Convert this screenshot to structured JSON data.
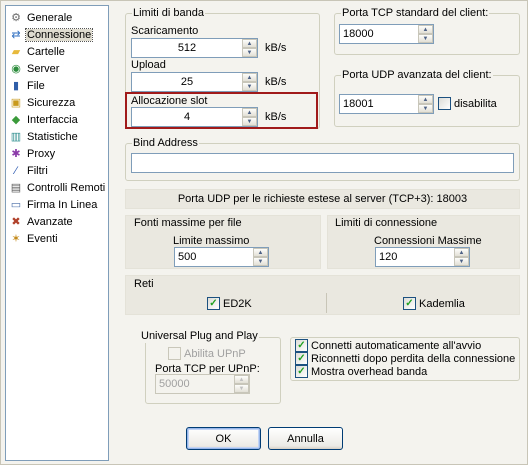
{
  "sidebar": {
    "items": [
      {
        "label": "Generale",
        "icon": "gear-icon",
        "glyph": "⚙",
        "color": "#6b6b6b",
        "selected": false
      },
      {
        "label": "Connessione",
        "icon": "connection-icon",
        "glyph": "⇄",
        "color": "#2e6ec0",
        "selected": true
      },
      {
        "label": "Cartelle",
        "icon": "folder-icon",
        "glyph": "▰",
        "color": "#e7b93c",
        "selected": false
      },
      {
        "label": "Server",
        "icon": "server-icon",
        "glyph": "◉",
        "color": "#2c8c3c",
        "selected": false
      },
      {
        "label": "File",
        "icon": "file-icon",
        "glyph": "▮",
        "color": "#2f5ea8",
        "selected": false
      },
      {
        "label": "Sicurezza",
        "icon": "lock-icon",
        "glyph": "▣",
        "color": "#c99a1c",
        "selected": false
      },
      {
        "label": "Interfaccia",
        "icon": "interface-icon",
        "glyph": "◆",
        "color": "#3a9a3a",
        "selected": false
      },
      {
        "label": "Statistiche",
        "icon": "statistics-icon",
        "glyph": "▥",
        "color": "#2f8f8f",
        "selected": false
      },
      {
        "label": "Proxy",
        "icon": "proxy-icon",
        "glyph": "✱",
        "color": "#8a3aa8",
        "selected": false
      },
      {
        "label": "Filtri",
        "icon": "filter-icon",
        "glyph": "∕",
        "color": "#2a58b0",
        "selected": false
      },
      {
        "label": "Controlli Remoti",
        "icon": "remote-control-icon",
        "glyph": "▤",
        "color": "#5a5a5a",
        "selected": false
      },
      {
        "label": "Firma In Linea",
        "icon": "signature-icon",
        "glyph": "▭",
        "color": "#4a6ea8",
        "selected": false
      },
      {
        "label": "Avanzate",
        "icon": "advanced-tools-icon",
        "glyph": "✖",
        "color": "#b0402a",
        "selected": false
      },
      {
        "label": "Eventi",
        "icon": "events-icon",
        "glyph": "✶",
        "color": "#c48a1a",
        "selected": false
      }
    ]
  },
  "bandwidth": {
    "title": "Limiti di banda",
    "download_label": "Scaricamento",
    "download_value": "512",
    "download_unit": "kB/s",
    "upload_label": "Upload",
    "upload_value": "25",
    "upload_unit": "kB/s",
    "slot_label": "Allocazione slot",
    "slot_value": "4",
    "slot_unit": "kB/s",
    "highlight_color": "#a01a1a"
  },
  "tcp_port": {
    "title": "Porta TCP standard del client:",
    "value": "18000"
  },
  "udp_port": {
    "title": "Porta UDP avanzata del client:",
    "value": "18001",
    "disable_label": "disabilita",
    "disable_checked": false
  },
  "bind": {
    "title": "Bind Address",
    "value": ""
  },
  "server_udp_info": "Porta UDP per le richieste estese al server (TCP+3): 18003",
  "max_sources": {
    "title": "Fonti massime per file",
    "label": "Limite massimo",
    "value": "500"
  },
  "connection_limits": {
    "title": "Limiti di connessione",
    "label": "Connessioni Massime",
    "value": "120"
  },
  "networks": {
    "title": "Reti",
    "ed2k_label": "ED2K",
    "ed2k_checked": true,
    "kad_label": "Kademlia",
    "kad_checked": true
  },
  "upnp": {
    "title": "Universal Plug and Play",
    "enable_label": "Abilita UPnP",
    "enable_checked": false,
    "port_label": "Porta TCP per UPnP:",
    "port_value": "50000"
  },
  "options": [
    {
      "label": "Connetti automaticamente all'avvio",
      "checked": true
    },
    {
      "label": "Riconnetti dopo perdita della connessione",
      "checked": true
    },
    {
      "label": "Mostra overhead banda",
      "checked": true
    }
  ],
  "buttons": {
    "ok": "OK",
    "cancel": "Annulla"
  }
}
